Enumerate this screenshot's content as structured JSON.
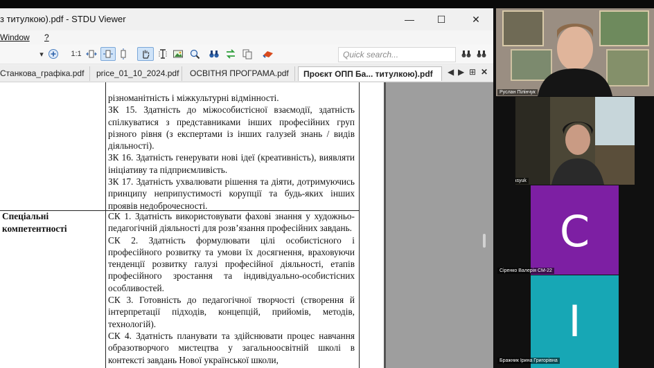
{
  "window": {
    "title": "з титулкою).pdf - STDU Viewer",
    "minimize": "—",
    "maximize": "☐",
    "close": "✕"
  },
  "menu": {
    "window": "Window",
    "help": "?"
  },
  "toolbar": {
    "zoom_actual": "1:1",
    "search_placeholder": "Quick search..."
  },
  "tabs": [
    {
      "label": "Станкова_графіка.pdf"
    },
    {
      "label": "price_01_10_2024.pdf"
    },
    {
      "label": "ОСВІТНЯ ПРОГРАМА.pdf"
    },
    {
      "label": "Проєкт ОПП Ба... титулкою).pdf"
    }
  ],
  "document": {
    "row1_lines": [
      "різноманітність і міжкультурні відмінності.",
      "ЗК 15. Здатність до міжособистісної взаємодії, здатність спілкуватися з представниками інших професійних груп різного рівня (з експертами із інших галузей знань / видів діяльності).",
      "ЗК 16. Здатність генерувати нові ідеї (креативність), виявляти ініціативу та підприємливість.",
      "ЗК 17. Здатність ухвалювати рішення та діяти, дотримуючись принципу неприпустимості корупції та будь-яких інших проявів недоброчесності."
    ],
    "row2_label_1": "Спеціальні",
    "row2_label_2": "компетентності",
    "row2_lines": [
      "СК 1. Здатність використовувати фахові знання у художньо-педагогічній діяльності для розв’язання професійних завдань.",
      "СК 2. Здатність формулювати цілі особистісного і професійного розвитку та умови їх досягнення, враховуючи тенденції розвитку галузі професійної діяльності, етапів професійного зростання та індивідуально-особистісних особливостей.",
      "СК 3. Готовність до педагогічної творчості (створення й інтерпретації підходів, концепцій, прийомів, методів, технологій).",
      "СК 4. Здатність планувати та здійснювати процес навчання образотворчого мистецтва у загальноосвітній школі в контексті завдань Нової української школи,"
    ]
  },
  "participants": [
    {
      "name": "Руслан Пілінчук"
    },
    {
      "name": "Irina Krasyuk"
    },
    {
      "name": "Сіренко Валерія СМ-22",
      "initial": "С",
      "color": "#7d1fa3"
    },
    {
      "name": "Бражник Ірина Григорівна",
      "initial": "І",
      "color": "#17a7b5"
    }
  ]
}
